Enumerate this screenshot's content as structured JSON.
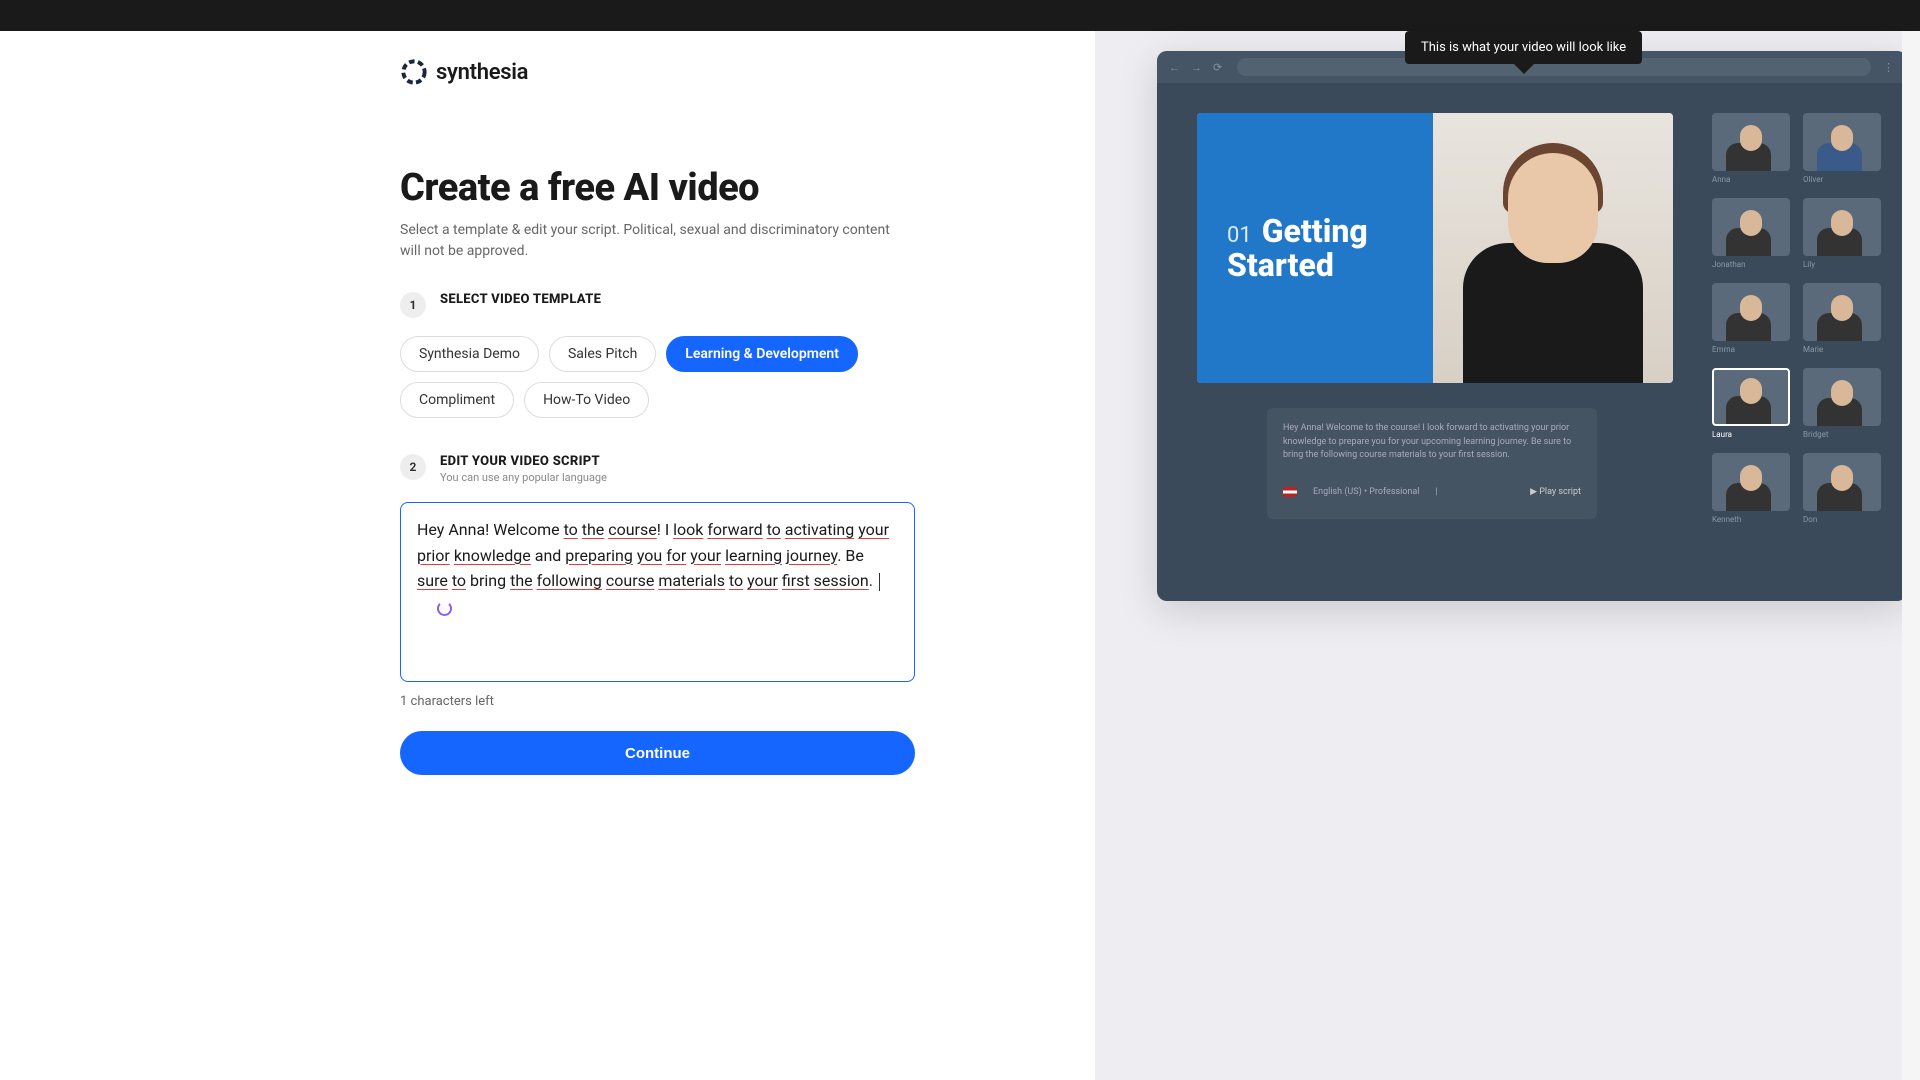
{
  "brand": {
    "name": "synthesia"
  },
  "page": {
    "title": "Create a free AI video",
    "subtitle": "Select a template & edit your script. Political, sexual and discriminatory content will not be approved."
  },
  "step1": {
    "num": "1",
    "heading": "SELECT VIDEO TEMPLATE",
    "templates": [
      "Synthesia Demo",
      "Sales Pitch",
      "Learning & Development",
      "Compliment",
      "How-To Video"
    ],
    "active": "Learning & Development"
  },
  "step2": {
    "num": "2",
    "heading": "EDIT YOUR VIDEO SCRIPT",
    "sub": "You can use any popular language",
    "script_plain": "Hey Anna! Welcome to the course! I look forward to activating your prior knowledge and preparing you for your learning journey. Be sure to bring the following course materials to your first session. ",
    "chars_left": "1 characters left"
  },
  "continue_label": "Continue",
  "preview": {
    "tooltip": "This is what your video will look like",
    "slide_num": "01",
    "slide_title1": "Getting",
    "slide_title2": "Started",
    "script_preview": "Hey Anna! Welcome to the course! I look forward to activating your prior knowledge to prepare you for your upcoming learning journey. Be sure to bring the following course materials to your first session.",
    "language": "English (US) • Professional",
    "play_label": "▶ Play script",
    "avatars": [
      "Anna",
      "Oliver",
      "Jonathan",
      "Lily",
      "Emma",
      "Marie",
      "Laura",
      "Bridget",
      "Kenneth",
      "Don"
    ],
    "selected_avatar": "Laura"
  }
}
